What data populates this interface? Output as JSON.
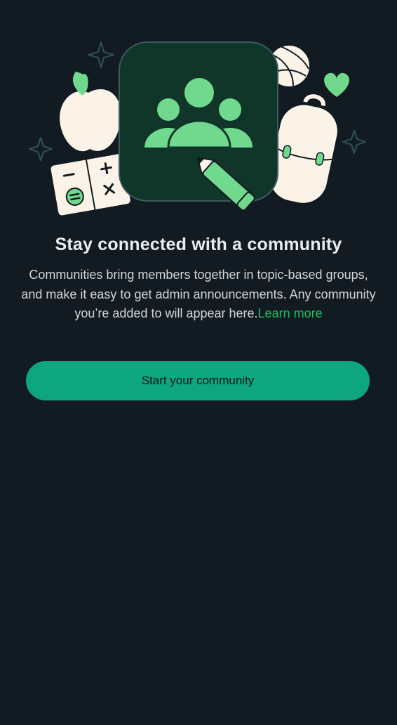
{
  "header": {
    "title": "Stay connected with a community"
  },
  "description": {
    "text": "Communities bring members together in topic-based groups, and make it easy to get admin announcements. Any community you’re added to will appear here.",
    "link_label": "Learn more"
  },
  "actions": {
    "start_label": "Start your community"
  },
  "illustration": {
    "items": [
      "community-icon",
      "apple-icon",
      "notebook-icon",
      "pencil-icon",
      "volleyball-icon",
      "heart-icon",
      "backpack-icon",
      "sparkle-icon"
    ]
  },
  "colors": {
    "background": "#121b22",
    "accent": "#21c063",
    "button": "#0ea67e",
    "tile": "#103529",
    "illustration_green": "#71d98d",
    "cream": "#fbf3e8"
  }
}
